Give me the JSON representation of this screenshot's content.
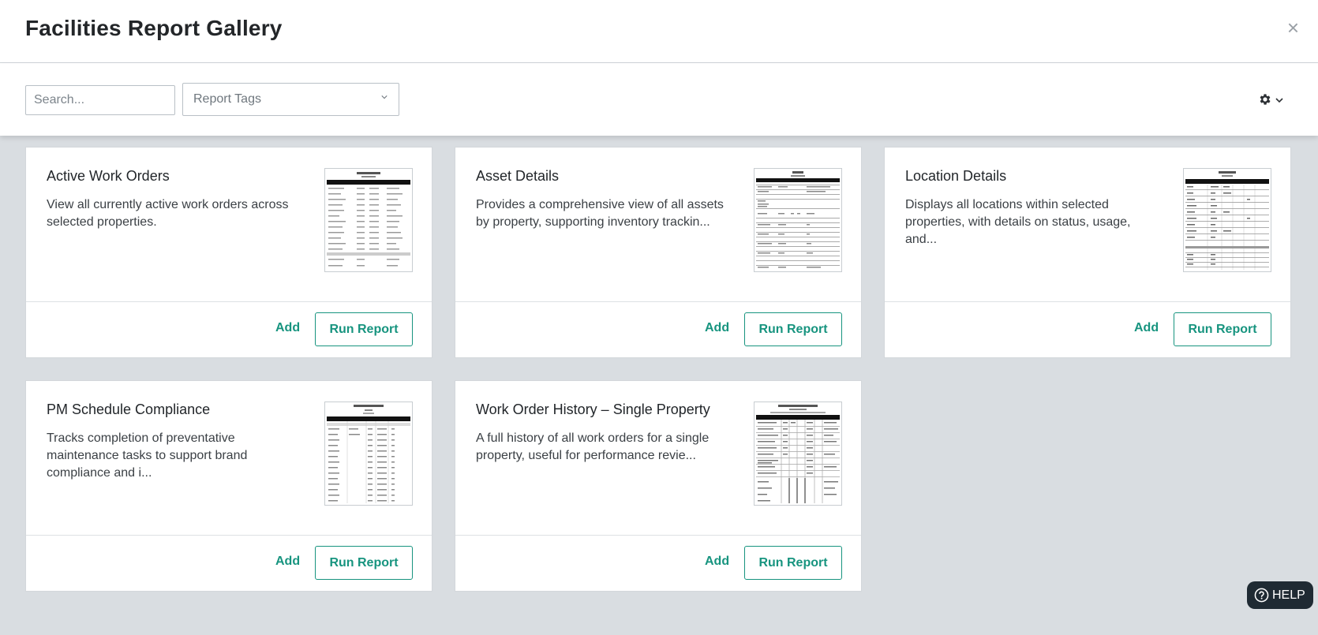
{
  "header": {
    "title": "Facilities Report Gallery",
    "close_glyph": "×"
  },
  "toolbar": {
    "search_placeholder": "Search...",
    "tags_placeholder": "Report Tags"
  },
  "cards": [
    {
      "title": "Active Work Orders",
      "description": "View all currently active work orders across selected properties.",
      "add_label": "Add",
      "run_label": "Run Report"
    },
    {
      "title": "Asset Details",
      "description": "Provides a comprehensive view of all assets by property, supporting inventory trackin...",
      "add_label": "Add",
      "run_label": "Run Report"
    },
    {
      "title": "Location Details",
      "description": "Displays all locations within selected properties, with details on status, usage, and...",
      "add_label": "Add",
      "run_label": "Run Report"
    },
    {
      "title": "PM Schedule Compliance",
      "description": "Tracks completion of preventative maintenance tasks to support brand compliance and i...",
      "add_label": "Add",
      "run_label": "Run Report"
    },
    {
      "title": "Work Order History – Single Property",
      "description": "A full history of all work orders for a single property, useful for performance revie...",
      "add_label": "Add",
      "run_label": "Run Report"
    }
  ],
  "help": {
    "label": "HELP"
  },
  "colors": {
    "accent": "#17947f",
    "background": "#d9dde1",
    "help_bg": "#1f2a33"
  },
  "icons": [
    "close-icon",
    "chevron-down-icon",
    "gear-icon",
    "question-circle-icon"
  ]
}
